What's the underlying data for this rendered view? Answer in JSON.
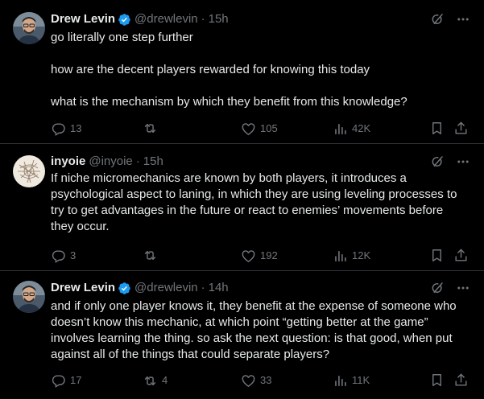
{
  "posts": [
    {
      "author": "Drew Levin",
      "handle": "@drewlevin",
      "separator": "·",
      "time": "15h",
      "verified": true,
      "avatar_icon": "avatar-photo",
      "paragraphs": [
        "go literally one step further",
        "how are the decent players rewarded for knowing this today",
        "what is the mechanism by which they benefit from this knowledge?"
      ],
      "stats": {
        "replies": "13",
        "reposts": "",
        "likes": "105",
        "views": "42K"
      }
    },
    {
      "author": "inyoie",
      "handle": "@inyoie",
      "separator": "·",
      "time": "15h",
      "verified": false,
      "avatar_icon": "avatar-sketch",
      "paragraphs": [
        "If niche micromechanics are known by both players, it introduces a psychological aspect to laning, in which they are using leveling processes to try to get advantages in the future or react to enemies’ movements before they occur."
      ],
      "stats": {
        "replies": "3",
        "reposts": "",
        "likes": "192",
        "views": "12K"
      }
    },
    {
      "author": "Drew Levin",
      "handle": "@drewlevin",
      "separator": "·",
      "time": "14h",
      "verified": true,
      "avatar_icon": "avatar-photo",
      "paragraphs": [
        "and if only one player knows it, they benefit at the expense of someone who doesn’t know this mechanic, at which point “getting better at the game” involves learning the thing. so ask the next question: is that good, when put against all of the things that could separate players?"
      ],
      "stats": {
        "replies": "17",
        "reposts": "4",
        "likes": "33",
        "views": "11K"
      }
    }
  ],
  "colors": {
    "background": "#000000",
    "text": "#e7e9ea",
    "muted": "#71767b",
    "divider": "#2f3336",
    "verified": "#1d9bf0"
  },
  "icons": [
    "reply-icon",
    "repost-icon",
    "like-icon",
    "views-icon",
    "bookmark-icon",
    "share-icon",
    "grok-icon",
    "more-icon",
    "verified-badge-icon"
  ]
}
